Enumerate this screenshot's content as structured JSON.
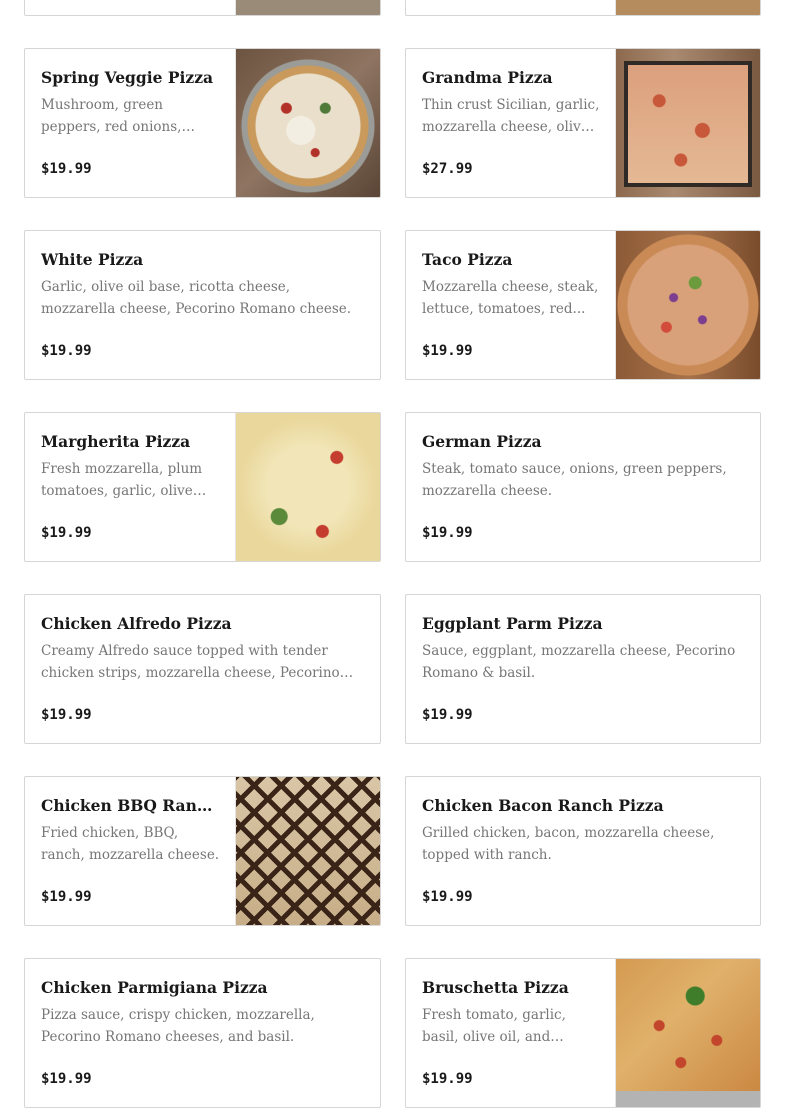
{
  "menu": {
    "items": [
      {
        "name": "Spring Veggie Pizza",
        "desc": "Mushroom, green peppers, red onions, black olives,...",
        "price": "$19.99",
        "image": "spring-veggie-pizza-photo"
      },
      {
        "name": "Grandma Pizza",
        "desc": "Thin crust Sicilian, garlic, mozzarella cheese, olive o...",
        "price": "$27.99",
        "image": "grandma-pizza-photo"
      },
      {
        "name": "White Pizza",
        "desc": "Garlic, olive oil base, ricotta cheese, mozzarella cheese, Pecorino Romano cheese.",
        "price": "$19.99"
      },
      {
        "name": "Taco Pizza",
        "desc": "Mozzarella cheese, steak, lettuce, tomatoes, red...",
        "price": "$19.99",
        "image": "taco-pizza-photo"
      },
      {
        "name": "Margherita Pizza",
        "desc": "Fresh mozzarella, plum tomatoes, garlic, olive oil,...",
        "price": "$19.99",
        "image": "margherita-pizza-photo"
      },
      {
        "name": "German Pizza",
        "desc": "Steak, tomato sauce, onions, green peppers, mozzarella cheese.",
        "price": "$19.99"
      },
      {
        "name": "Chicken Alfredo Pizza",
        "desc": "Creamy Alfredo sauce topped with tender chicken strips, mozzarella cheese, Pecorino Romano...",
        "price": "$19.99"
      },
      {
        "name": "Eggplant Parm Pizza",
        "desc": "Sauce, eggplant, mozzarella cheese, Pecorino Romano & basil.",
        "price": "$19.99"
      },
      {
        "name": "Chicken BBQ Ranch...",
        "desc": "Fried chicken, BBQ, ranch, mozzarella cheese.",
        "price": "$19.99",
        "image": "chicken-bbq-ranch-pizza-photo"
      },
      {
        "name": "Chicken Bacon Ranch Pizza",
        "desc": "Grilled chicken, bacon, mozzarella cheese, topped with ranch.",
        "price": "$19.99"
      },
      {
        "name": "Chicken Parmigiana Pizza",
        "desc": "Pizza sauce, crispy chicken, mozzarella, Pecorino Romano cheeses, and basil.",
        "price": "$19.99"
      },
      {
        "name": "Bruschetta Pizza",
        "desc": "Fresh tomato, garlic, basil, olive oil, and parmesan...",
        "price": "$19.99",
        "image": "bruschetta-pizza-photo"
      }
    ]
  }
}
